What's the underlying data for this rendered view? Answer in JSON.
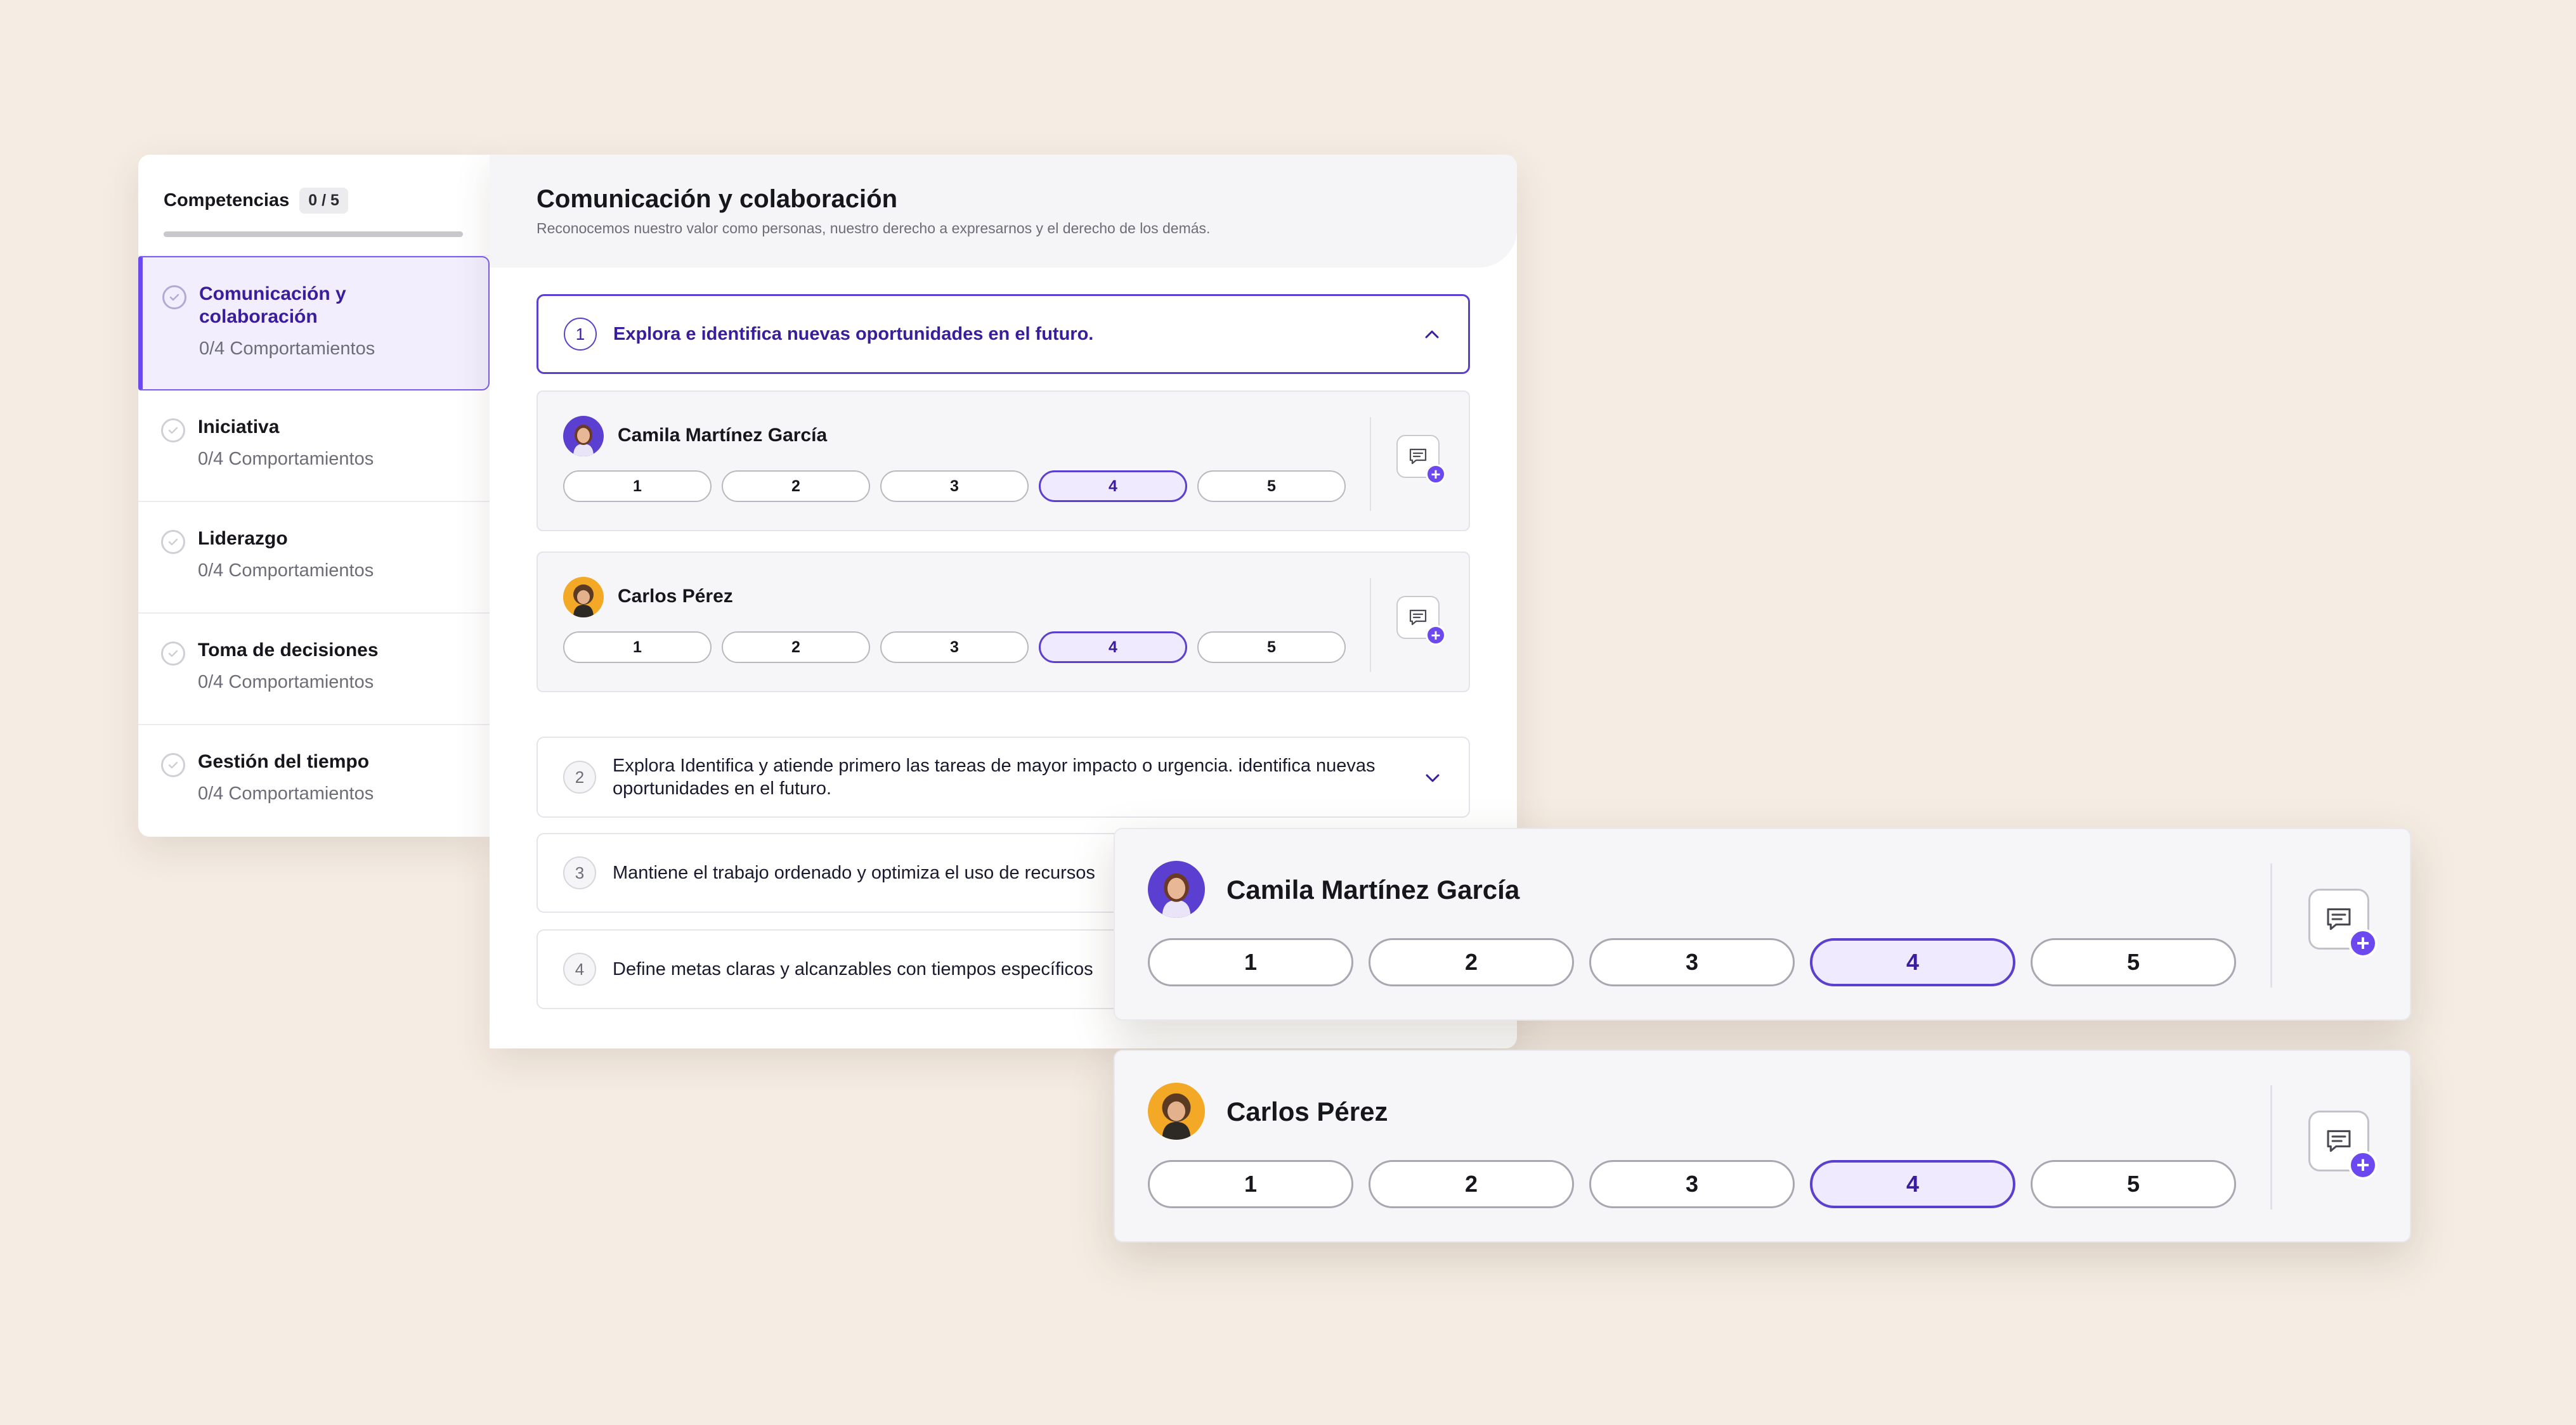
{
  "sidebar": {
    "title": "Competencias",
    "count": "0 / 5",
    "items": [
      {
        "name": "Comunicación y colaboración",
        "sub": "0/4 Comportamientos",
        "active": true
      },
      {
        "name": "Iniciativa",
        "sub": "0/4 Comportamientos"
      },
      {
        "name": "Liderazgo",
        "sub": "0/4 Comportamientos"
      },
      {
        "name": "Toma de decisiones",
        "sub": "0/4 Comportamientos"
      },
      {
        "name": "Gestión del tiempo",
        "sub": "0/4 Comportamientos"
      }
    ]
  },
  "main": {
    "title": "Comunicación y colaboración",
    "description": "Reconocemos nuestro valor como personas, nuestro derecho a expresarnos y el derecho de los demás.",
    "behaviors": [
      {
        "num": "1",
        "text": "Explora e identifica nuevas oportunidades en el futuro.",
        "expanded": true
      },
      {
        "num": "2",
        "text": "Explora Identifica y atiende primero las tareas de mayor impacto o urgencia. identifica nuevas oportunidades en el futuro."
      },
      {
        "num": "3",
        "text": "Mantiene el trabajo ordenado y optimiza el uso de recursos"
      },
      {
        "num": "4",
        "text": "Define metas claras y alcanzables con tiempos específicos"
      }
    ],
    "raters": [
      {
        "name": "Camila Martínez García",
        "selected": 4,
        "avatar_bg": "#5b3fd0"
      },
      {
        "name": "Carlos Pérez",
        "selected": 4,
        "avatar_bg": "#f3a826"
      }
    ],
    "scale": [
      "1",
      "2",
      "3",
      "4",
      "5"
    ]
  },
  "cards": [
    {
      "name": "Camila Martínez García",
      "selected": 4
    },
    {
      "name": "Carlos Pérez",
      "selected": 4
    }
  ],
  "colors": {
    "accent": "#5b3fd0",
    "accent_dark": "#3a1d9e",
    "accent_light": "#efeafd",
    "background": "#f5ece3"
  },
  "icons": [
    "check-circle-icon",
    "chevron-up-icon",
    "chevron-down-icon",
    "comment-icon",
    "plus-icon"
  ]
}
